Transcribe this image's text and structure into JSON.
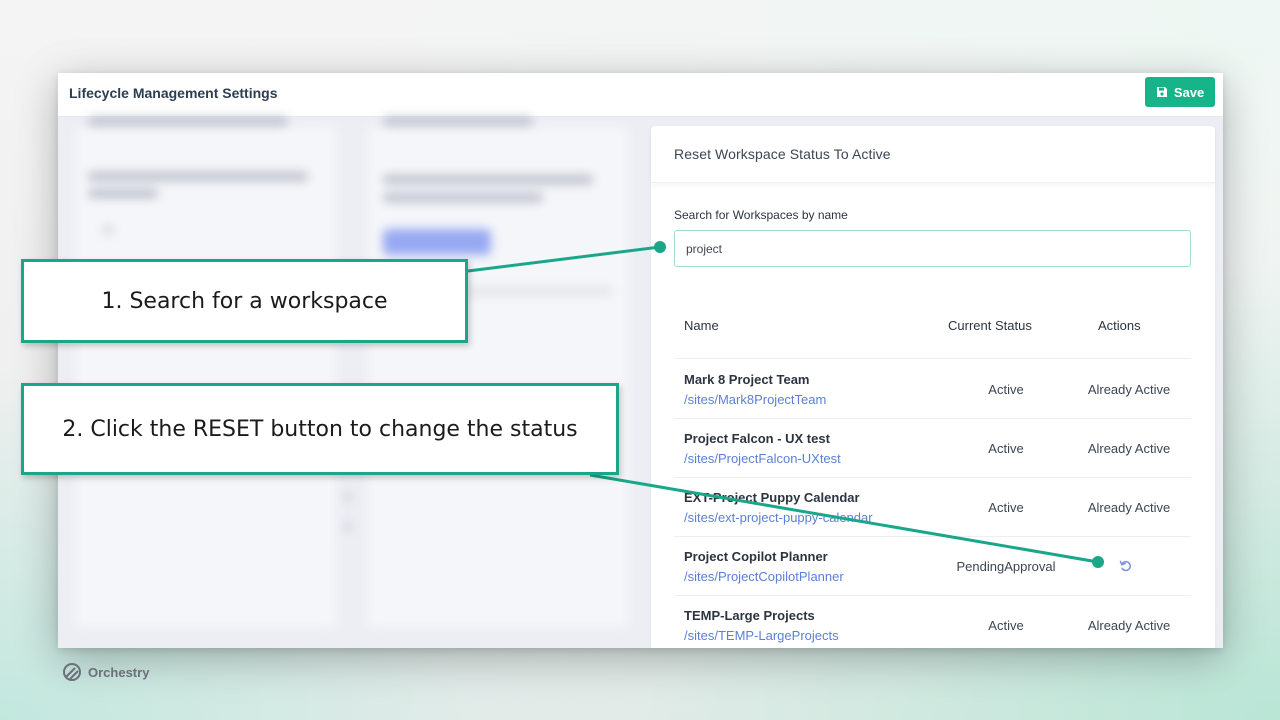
{
  "app": {
    "title": "Lifecycle Management Settings",
    "save_label": "Save",
    "accent_color": "#16b488"
  },
  "panel": {
    "title": "Reset Workspace Status To Active",
    "search_label": "Search for Workspaces by name",
    "search_value": "project"
  },
  "table": {
    "headers": [
      "Name",
      "Current Status",
      "Actions"
    ],
    "rows": [
      {
        "name": "Mark 8 Project Team",
        "url": "/sites/Mark8ProjectTeam",
        "status": "Active",
        "action": "Already Active"
      },
      {
        "name": "Project Falcon - UX test",
        "url": "/sites/ProjectFalcon-UXtest",
        "status": "Active",
        "action": "Already Active"
      },
      {
        "name": "EXT-Project Puppy Calendar",
        "url": "/sites/ext-project-puppy-calendar",
        "status": "Active",
        "action": "Already Active"
      },
      {
        "name": "Project Copilot Planner",
        "url": "/sites/ProjectCopilotPlanner",
        "status": "PendingApproval",
        "action": "",
        "action_icon": "reset-icon"
      },
      {
        "name": "TEMP-Large Projects",
        "url": "/sites/TEMP-LargeProjects",
        "status": "Active",
        "action": "Already Active"
      }
    ]
  },
  "callouts": [
    {
      "text": "1. Search for a workspace"
    },
    {
      "text": "2. Click the RESET button to change the status"
    }
  ],
  "brand": {
    "name": "Orchestry",
    "icon": "orchestry-logo-icon"
  },
  "colors": {
    "callout_border": "#1aa688",
    "link": "#5b7fd6"
  }
}
